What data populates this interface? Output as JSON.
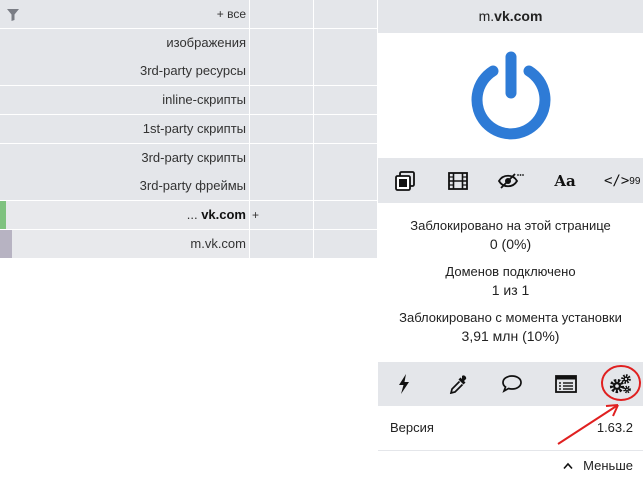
{
  "firewall": {
    "rows": [
      {
        "label": "+ все",
        "prefix": "",
        "host": "",
        "plus": "",
        "marker": ""
      },
      {
        "label": "изображения",
        "prefix": "",
        "host": "",
        "plus": "",
        "marker": ""
      },
      {
        "label": "3rd-party ресурсы",
        "prefix": "",
        "host": "",
        "plus": "",
        "marker": ""
      },
      {
        "label": "inline-скрипты",
        "prefix": "",
        "host": "",
        "plus": "",
        "marker": ""
      },
      {
        "label": "1st-party скрипты",
        "prefix": "",
        "host": "",
        "plus": "",
        "marker": ""
      },
      {
        "label": "3rd-party скрипты",
        "prefix": "",
        "host": "",
        "plus": "",
        "marker": ""
      },
      {
        "label": "3rd-party фреймы",
        "prefix": "",
        "host": "",
        "plus": "",
        "marker": ""
      },
      {
        "label": "",
        "prefix": "... ",
        "host": "vk.com",
        "plus": "+",
        "marker": "#7fc27f"
      },
      {
        "label": "m.vk.com",
        "prefix": "",
        "host": "",
        "plus": "",
        "marker": "#b7b3c2"
      }
    ]
  },
  "popup": {
    "hostname_prefix": "m.",
    "hostname_domain": "vk.com",
    "power_color": "#2e7bd6",
    "tools": {
      "popups_icon": "popup-block-icon",
      "media_icon": "film-icon",
      "cosmetic_icon": "eye-slash-icon",
      "fonts_label": "Aa",
      "scripts_label": "</>",
      "scripts_badge": "99"
    },
    "stats": {
      "blocked_page_label": "Заблокировано на этой странице",
      "blocked_page_value": "0 (0%)",
      "domains_label": "Доменов подключено",
      "domains_value": "1 из 1",
      "blocked_total_label": "Заблокировано с момента установки",
      "blocked_total_value": "3,91 млн (10%)"
    },
    "toolbar": {
      "zap_icon": "lightning-icon",
      "picker_icon": "eyedropper-icon",
      "report_icon": "speech-bubble-icon",
      "logger_icon": "list-window-icon",
      "dashboard_icon": "gears-icon"
    },
    "version_label": "Версия",
    "version_value": "1.63.2",
    "less_label": "Меньше"
  },
  "annotation_color": "#e02020"
}
